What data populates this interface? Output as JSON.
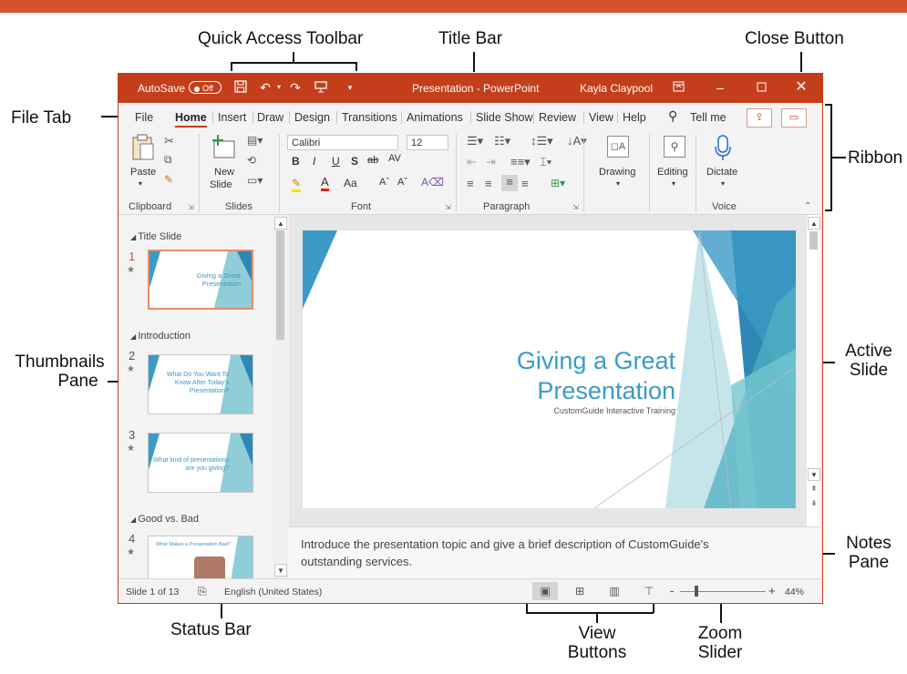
{
  "labels": {
    "quick_access_toolbar": "Quick Access Toolbar",
    "title_bar": "Title Bar",
    "close_button": "Close Button",
    "file_tab": "File Tab",
    "ribbon": "Ribbon",
    "thumbnails_pane": [
      "Thumbnails",
      "Pane"
    ],
    "active_slide": [
      "Active",
      "Slide"
    ],
    "notes_pane": [
      "Notes",
      "Pane"
    ],
    "status_bar": "Status Bar",
    "view_buttons": [
      "View",
      "Buttons"
    ],
    "zoom_slider": [
      "Zoom",
      "Slider"
    ]
  },
  "titlebar": {
    "autosave": "AutoSave",
    "autosave_state": "Off",
    "title": "Presentation - PowerPoint",
    "user": "Kayla Claypool",
    "icons": [
      "save-icon",
      "undo-icon",
      "redo-icon",
      "start-presentation-icon",
      "customize-icon",
      "ribbon-display-icon",
      "minimize-icon",
      "maximize-icon",
      "close-icon"
    ]
  },
  "menu": {
    "items": [
      "File",
      "Home",
      "Insert",
      "Draw",
      "Design",
      "Transitions",
      "Animations",
      "Slide Show",
      "Review",
      "View",
      "Help"
    ],
    "active": "Home",
    "tellme": "Tell me"
  },
  "ribbon": {
    "groups": [
      "Clipboard",
      "Slides",
      "Font",
      "Paragraph",
      "Voice"
    ],
    "paste": "Paste",
    "new_slide": [
      "New",
      "Slide"
    ],
    "font_name": "Calibri",
    "font_size": "12",
    "font_buttons": [
      "B",
      "I",
      "U",
      "S",
      "ab",
      "AV",
      "A",
      "Aa",
      "Aˆ",
      "Aˇ"
    ],
    "drawing": "Drawing",
    "editing": "Editing",
    "dictate": "Dictate",
    "accent": "#c43e1c"
  },
  "thumbnails": {
    "sections": [
      "Title Slide",
      "Introduction",
      "Good vs. Bad"
    ],
    "slides": [
      {
        "num": "1",
        "title": [
          "Giving a Great",
          "Presentation"
        ]
      },
      {
        "num": "2",
        "title": [
          "What Do You Want To",
          "Know After Today's",
          "Presentation?"
        ]
      },
      {
        "num": "3",
        "title": [
          "What kind of presentations",
          "are you giving?"
        ]
      },
      {
        "num": "4",
        "title": [
          "What Makes a Presentation Bad?"
        ]
      }
    ]
  },
  "slide": {
    "title": [
      "Giving a Great",
      "Presentation"
    ],
    "subtitle": "CustomGuide Interactive Training",
    "title_color": "#3b9ac6"
  },
  "notes": {
    "text": "Introduce the presentation topic and give a brief description of CustomGuide's outstanding services."
  },
  "status": {
    "slide_count": "Slide 1 of 13",
    "language": "English (United States)",
    "zoom": "44%",
    "view_icons": [
      "normal-view-icon",
      "slide-sorter-icon",
      "reading-view-icon",
      "slide-show-icon"
    ]
  }
}
